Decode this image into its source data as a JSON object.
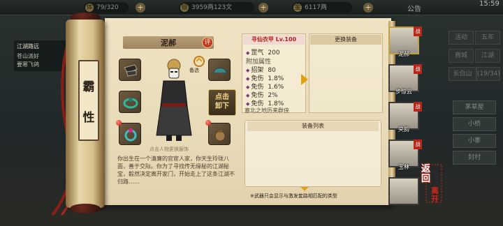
{
  "topbar": {
    "stat1": "79/320",
    "stat2": "3959两123文",
    "stat3": "6117两",
    "announcement": "公告",
    "clock": "15:59"
  },
  "quests": {
    "q1": "江湖路远",
    "q2": "苍山派好",
    "q3": "要寒飞鸽"
  },
  "right_menu": {
    "items": [
      "活动",
      "五年",
      "商城",
      "江湖",
      "长白山"
    ],
    "level": "(19/34)",
    "list": [
      "茅草屋",
      "小桥",
      "小寨",
      "封村"
    ]
  },
  "scroll": {
    "name_chars": [
      "霸",
      "性"
    ]
  },
  "character": {
    "name": "泥郝",
    "review_badge": "评",
    "spare_label": "备选",
    "hint": "点击人物更换服饰",
    "unequip_label": "点击\n卸下",
    "bio": "你出生在一个清廉的官宦人家，你天生玲珑八面，善于交际。你为了寻找传无缘秘的江湖秘宝，毅然决定离开家门，开始走上了这条江湖不归路……"
  },
  "item": {
    "title": "寻仙衣甲 Lv.100",
    "base_stat": "罡气",
    "base_value": "200",
    "extra_header": "附加属性",
    "attrs": [
      {
        "name": "招架",
        "value": "80"
      },
      {
        "name": "免伤",
        "value": "1.8%"
      },
      {
        "name": "免伤",
        "value": "1.6%"
      },
      {
        "name": "免伤",
        "value": "2%"
      },
      {
        "name": "免伤",
        "value": "1.8%"
      }
    ],
    "set_name": "塞北之地历来群侠"
  },
  "replace": {
    "title": "更换装备"
  },
  "equip_list": {
    "title": "装备列表",
    "note": "※武器只会显示与激发套路相匹配的类型"
  },
  "party": [
    {
      "name": "泥郝",
      "badge": "战",
      "selected": true
    },
    {
      "name": "步惊云",
      "badge": "战",
      "selected": false
    },
    {
      "name": "央韵",
      "badge": "战",
      "selected": false
    },
    {
      "name": "玉林",
      "badge": "战",
      "selected": false
    },
    {
      "name": "",
      "badge": "",
      "selected": false
    }
  ],
  "back": {
    "label": "返回",
    "leave": "离开"
  },
  "colors": {
    "paper": "#ebdfbe",
    "accent_red": "#b0231a",
    "gold": "#e0a010"
  }
}
